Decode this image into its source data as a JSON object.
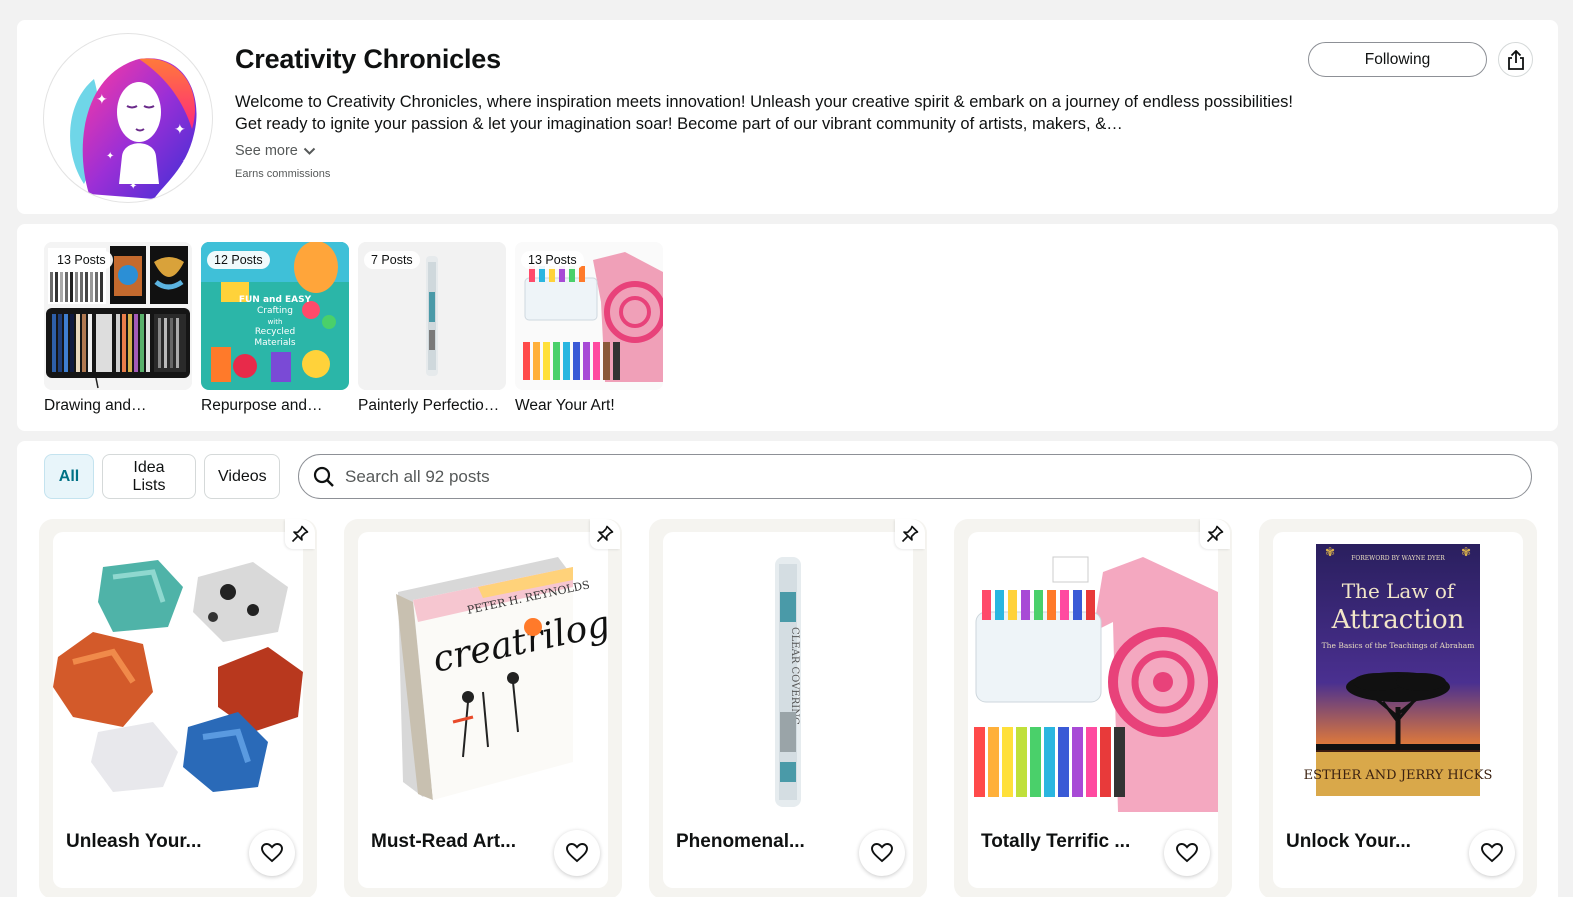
{
  "profile": {
    "title": "Creativity Chronicles",
    "description": "Welcome to Creativity Chronicles, where inspiration meets innovation! Unleash your creative spirit & embark on a journey of endless possibilities! Get ready to ignite your passion & let your imagination soar! Become part of our vibrant community of artists, makers, &…",
    "see_more": "See more",
    "earns": "Earns commissions",
    "following_label": "Following",
    "share_icon": "share-icon"
  },
  "idea_lists": [
    {
      "badge": "13 Posts",
      "label": "Drawing and…"
    },
    {
      "badge": "12 Posts",
      "label": "Repurpose and…"
    },
    {
      "badge": "7 Posts",
      "label": "Painterly Perfectio…"
    },
    {
      "badge": "13 Posts",
      "label": "Wear Your Art!"
    }
  ],
  "list_art": {
    "book_title": "FUN and EASY Crafting with Recycled Materials"
  },
  "filters": {
    "all": "All",
    "idea_lists": "Idea Lists",
    "videos": "Videos"
  },
  "search": {
    "placeholder": "Search all 92 posts"
  },
  "posts": [
    {
      "title": "Unleash Your..."
    },
    {
      "title": "Must-Read Art..."
    },
    {
      "title": "Phenomenal..."
    },
    {
      "title": "Totally Terrific ..."
    },
    {
      "title": "Unlock Your..."
    }
  ],
  "post_art": {
    "creatrilogy_author": "PETER H. REYNOLDS",
    "creatrilogy_title": "creatrilogy",
    "roll_text": "CLEAR COVERING",
    "book_foreword": "FOREWORD BY WAYNE DYER",
    "book_title_1": "The Law of",
    "book_title_2": "Attraction",
    "book_subtitle": "The Basics of the Teachings of Abraham",
    "book_authors": "ESTHER AND JERRY HICKS"
  },
  "colors": {
    "accent": "#007185",
    "active_bg": "#e8f5fa"
  }
}
